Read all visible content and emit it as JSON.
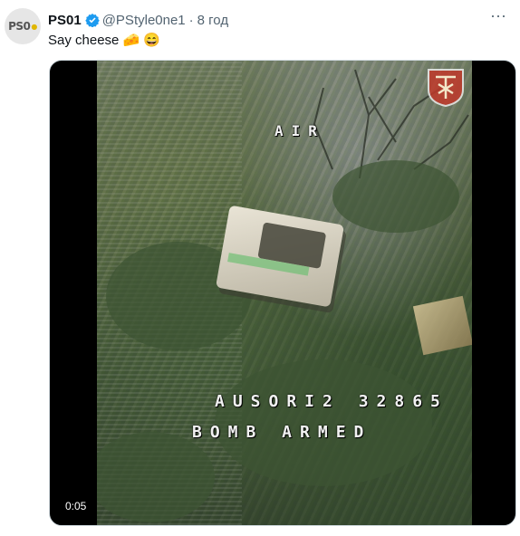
{
  "tweet": {
    "avatar_text": "PS0",
    "display_name": "PS01",
    "handle": "@PStyle0ne1",
    "separator": "·",
    "time": "8 год",
    "text": "Say cheese 🧀 😄"
  },
  "media": {
    "osd_top": "AIR",
    "osd_line1": "AUSORI2 32865",
    "osd_line2": "BOMB ARMED",
    "duration": "0:05"
  },
  "icons": {
    "verified": "verified-badge-icon",
    "more": "more-options-icon",
    "unit": "unit-emblem-icon"
  },
  "colors": {
    "verified": "#1d9bf0",
    "muted_text": "#536471",
    "emblem": "#c0392b"
  }
}
